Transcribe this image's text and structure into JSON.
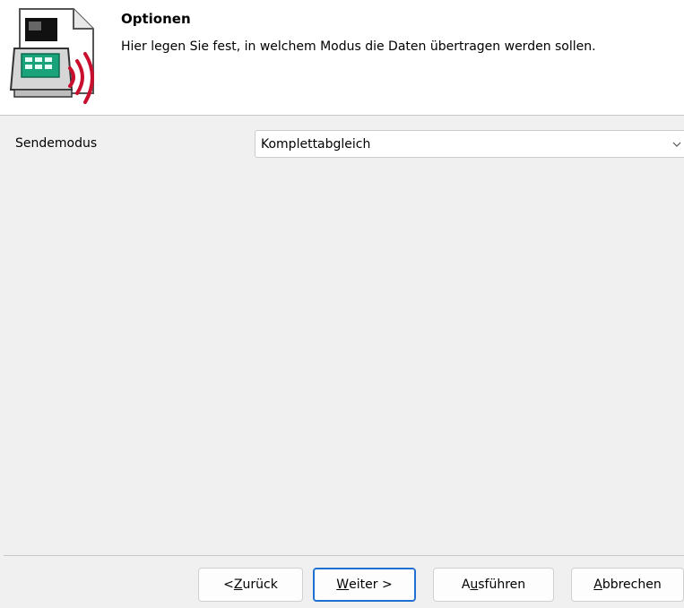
{
  "header": {
    "title": "Optionen",
    "description": "Hier legen Sie fest, in welchem Modus die Daten übertragen werden sollen.",
    "icon": "fiscal-printer-transmit-icon"
  },
  "form": {
    "send_mode_label": "Sendemodus",
    "send_mode_value": "Komplettabgleich"
  },
  "buttons": {
    "back": {
      "pre": "< ",
      "mnemonic": "Z",
      "rest": "urück"
    },
    "next": {
      "pre": "",
      "mnemonic": "W",
      "rest": "eiter >"
    },
    "run": {
      "pre": "A",
      "mnemonic": "u",
      "rest": "sführen"
    },
    "cancel": {
      "pre": "",
      "mnemonic": "A",
      "rest": "bbrechen"
    }
  },
  "colors": {
    "accent": "#1f6fd0",
    "icon_red": "#c8102e",
    "icon_green": "#1aa37a"
  }
}
